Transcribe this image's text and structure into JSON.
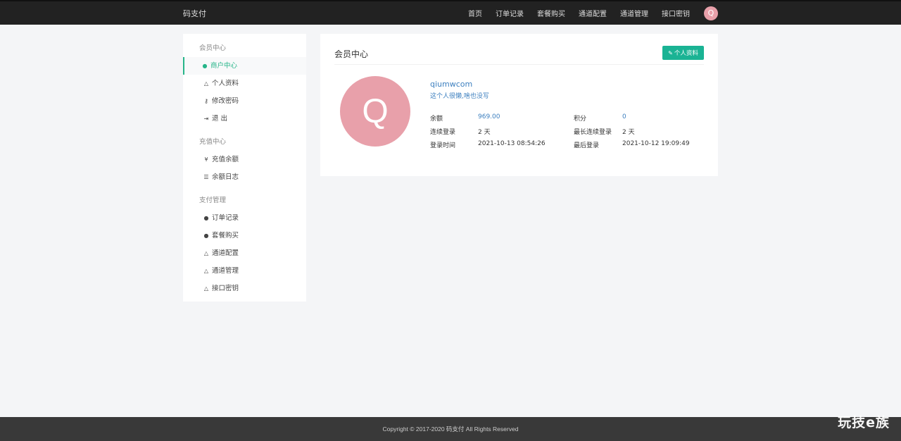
{
  "topbar": {
    "brand": "码支付",
    "nav": [
      "首页",
      "订单记录",
      "套餐购买",
      "通道配置",
      "通道管理",
      "接口密钥"
    ],
    "avatar_letter": "Q"
  },
  "sidebar": {
    "groups": [
      {
        "label": "会员中心",
        "items": [
          {
            "label": "商户中心",
            "icon": "user-circle-icon",
            "active": true
          },
          {
            "label": "个人资料",
            "icon": "lock-icon"
          },
          {
            "label": "修改密码",
            "icon": "key-icon"
          },
          {
            "label": "退 出",
            "icon": "sign-out-icon"
          }
        ]
      },
      {
        "label": "充值中心",
        "items": [
          {
            "label": "充值余额",
            "icon": "yen-icon"
          },
          {
            "label": "余额日志",
            "icon": "list-icon"
          }
        ]
      },
      {
        "label": "支付管理",
        "items": [
          {
            "label": "订单记录",
            "icon": "user-circle-icon"
          },
          {
            "label": "套餐购买",
            "icon": "user-circle-icon"
          },
          {
            "label": "通道配置",
            "icon": "lock-icon"
          },
          {
            "label": "通道管理",
            "icon": "lock-icon"
          },
          {
            "label": "接口密钥",
            "icon": "lock-icon"
          }
        ]
      }
    ]
  },
  "main": {
    "title": "会员中心",
    "profile_button": "个人资料",
    "avatar_letter": "Q",
    "username": "qiumwcom",
    "signature": "这个人很懒,啥也没写",
    "stats": {
      "balance_label": "余额",
      "balance_value": "969.00",
      "points_label": "积分",
      "points_value": "0",
      "streak_label": "连续登录",
      "streak_value": "2 天",
      "max_streak_label": "最长连续登录",
      "max_streak_value": "2 天",
      "login_time_label": "登录时间",
      "login_time_value": "2021-10-13 08:54:26",
      "last_login_label": "最后登录",
      "last_login_value": "2021-10-12 19:09:49"
    }
  },
  "footer": {
    "copyright": "Copyright © 2017-2020 码支付 All Rights Reserved"
  },
  "watermark": "玩技e族",
  "colors": {
    "accent": "#1ab394",
    "avatar": "#e8a0aa",
    "link": "#3c7fbf",
    "topbar": "#222222",
    "footer": "#393939"
  }
}
